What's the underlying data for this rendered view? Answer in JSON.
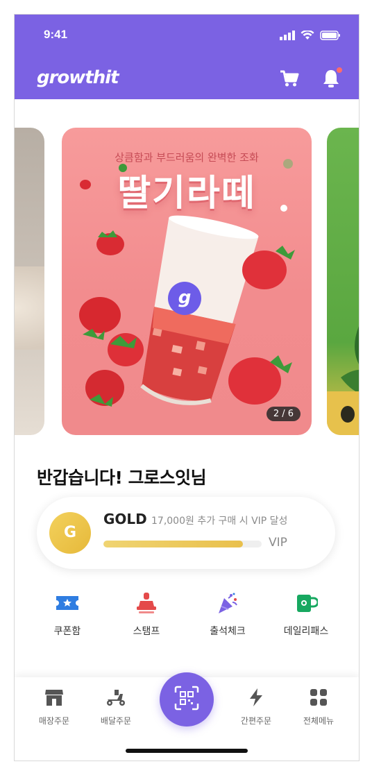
{
  "status": {
    "time": "9:41",
    "icons": [
      "signal-icon",
      "wifi-icon",
      "battery-icon"
    ]
  },
  "header": {
    "logo": "growthit",
    "icons": [
      "cart-icon",
      "bell-icon"
    ],
    "notification_dot": true,
    "bg_color": "#7b62e3"
  },
  "carousel": {
    "slide": {
      "subtitle": "상큼함과 부드러움의 완벽한 조화",
      "title": "딸기라떼",
      "logo_letter": "g"
    },
    "pager": "2 / 6"
  },
  "greeting": "반갑습니다! 그로스잇님",
  "membership": {
    "coin_letter": "G",
    "tier": "GOLD",
    "description": "17,000원 추가 구매 시 VIP 달성",
    "progress": 0.88,
    "target": "VIP"
  },
  "quick_menu": [
    {
      "label": "쿠폰함",
      "icon": "coupon-icon",
      "color": "#2f7de1"
    },
    {
      "label": "스탬프",
      "icon": "stamp-icon",
      "color": "#e44a4a"
    },
    {
      "label": "출석체크",
      "icon": "party-popper-icon",
      "color": "#7b62e3"
    },
    {
      "label": "데일리패스",
      "icon": "mug-icon",
      "color": "#17a860"
    }
  ],
  "tabbar": {
    "items": [
      {
        "label": "매장주문",
        "icon": "store-icon"
      },
      {
        "label": "배달주문",
        "icon": "scooter-icon"
      },
      {
        "label": "",
        "icon": "qr-scan-icon"
      },
      {
        "label": "간편주문",
        "icon": "lightning-icon"
      },
      {
        "label": "전체메뉴",
        "icon": "grid-menu-icon"
      }
    ]
  }
}
